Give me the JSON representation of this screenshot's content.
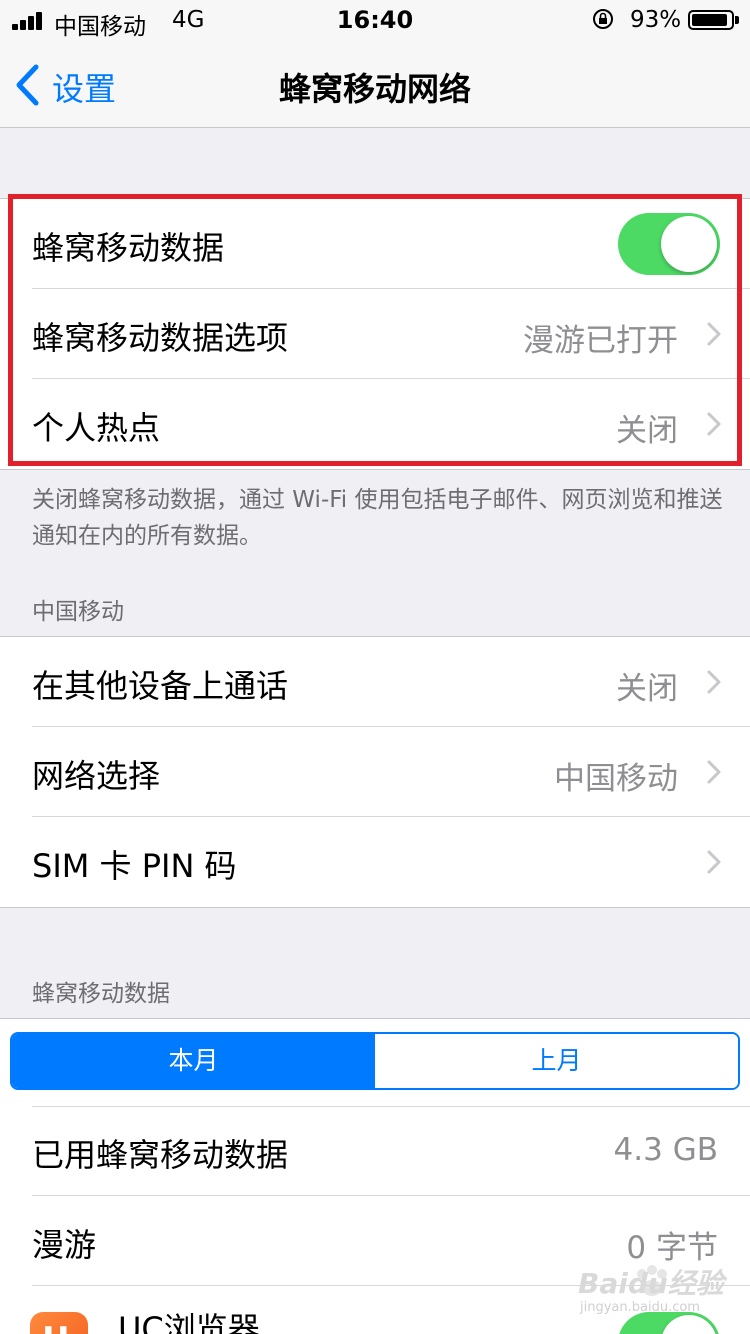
{
  "status_bar": {
    "carrier": "中国移动",
    "network": "4G",
    "time": "16:40",
    "battery_percent": "93%",
    "battery_level": 0.93,
    "signal_bars": 4
  },
  "nav": {
    "back_label": "设置",
    "title": "蜂窝移动网络"
  },
  "group1": {
    "cellular_data": {
      "label": "蜂窝移动数据",
      "enabled": true
    },
    "cellular_options": {
      "label": "蜂窝移动数据选项",
      "value": "漫游已打开"
    },
    "hotspot": {
      "label": "个人热点",
      "value": "关闭"
    },
    "footer": "关闭蜂窝移动数据，通过 Wi-Fi 使用包括电子邮件、网页浏览和推送通知在内的所有数据。"
  },
  "carrier_section": {
    "header": "中国移动",
    "other_devices": {
      "label": "在其他设备上通话",
      "value": "关闭"
    },
    "network_selection": {
      "label": "网络选择",
      "value": "中国移动"
    },
    "sim_pin": {
      "label": "SIM 卡 PIN 码"
    }
  },
  "usage_section": {
    "header": "蜂窝移动数据",
    "segments": [
      "本月",
      "上月"
    ],
    "selected_segment": 0,
    "used": {
      "label": "已用蜂窝移动数据",
      "value": "4.3 GB"
    },
    "roaming": {
      "label": "漫游",
      "value": "0 字节"
    },
    "app": {
      "label": "UC浏览器",
      "icon_letter": "U",
      "enabled": true
    }
  },
  "colors": {
    "accent": "#007aff",
    "toggle_on": "#4cd964",
    "highlight": "#e0202a"
  },
  "watermark": {
    "text": "Baidu经验",
    "url": "jingyan.baidu.com"
  }
}
